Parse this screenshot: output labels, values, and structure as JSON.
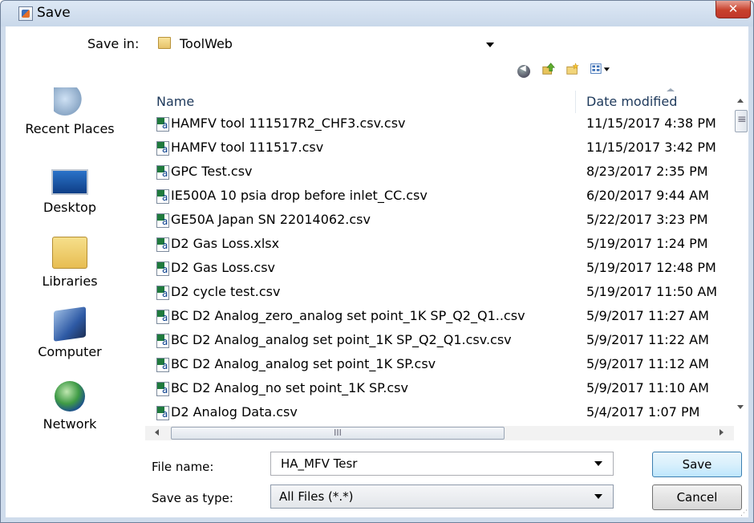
{
  "window": {
    "title": "Save",
    "close_symbol": "✕",
    "title_icon": "java-cup-icon"
  },
  "save_in": {
    "label": "Save in:",
    "value": "ToolWeb",
    "icon": "folder-icon"
  },
  "toolbar": {
    "icons": [
      "back-icon",
      "up-folder-icon",
      "new-folder-icon",
      "view-menu-icon"
    ]
  },
  "places": [
    {
      "label": "Recent Places",
      "icon": "recent-places-icon"
    },
    {
      "label": "Desktop",
      "icon": "desktop-icon"
    },
    {
      "label": "Libraries",
      "icon": "libraries-icon"
    },
    {
      "label": "Computer",
      "icon": "computer-icon"
    },
    {
      "label": "Network",
      "icon": "network-icon"
    }
  ],
  "file_list": {
    "columns": [
      "Name",
      "Date modified"
    ],
    "rows": [
      {
        "name": "HAMFV tool 111517R2_CHF3.csv.csv",
        "date": "11/15/2017 4:38 PM"
      },
      {
        "name": "HAMFV tool 111517.csv",
        "date": "11/15/2017 3:42 PM"
      },
      {
        "name": "GPC Test.csv",
        "date": "8/23/2017 2:35 PM"
      },
      {
        "name": "IE500A 10 psia drop before inlet_CC.csv",
        "date": "6/20/2017 9:44 AM"
      },
      {
        "name": "GE50A Japan SN 22014062.csv",
        "date": "5/22/2017 3:23 PM"
      },
      {
        "name": "D2 Gas Loss.xlsx",
        "date": "5/19/2017 1:24 PM"
      },
      {
        "name": "D2 Gas Loss.csv",
        "date": "5/19/2017 12:48 PM"
      },
      {
        "name": "D2 cycle test.csv",
        "date": "5/19/2017 11:50 AM"
      },
      {
        "name": "BC D2 Analog_zero_analog set point_1K SP_Q2_Q1..csv",
        "date": "5/9/2017 11:27 AM"
      },
      {
        "name": "BC D2 Analog_analog set point_1K SP_Q2_Q1.csv.csv",
        "date": "5/9/2017 11:22 AM"
      },
      {
        "name": "BC D2 Analog_analog set point_1K SP.csv",
        "date": "5/9/2017 11:12 AM"
      },
      {
        "name": "BC D2 Analog_no set point_1K SP.csv",
        "date": "5/9/2017 11:10 AM"
      },
      {
        "name": "D2 Analog Data.csv",
        "date": "5/4/2017 1:07 PM"
      }
    ]
  },
  "scrollbar": {
    "h_thumb_grip": "III"
  },
  "file_name": {
    "label": "File name:",
    "value": "HA_MFV Tesr"
  },
  "save_as_type": {
    "label": "Save as type:",
    "value": "All Files (*.*)"
  },
  "buttons": {
    "save": "Save",
    "cancel": "Cancel"
  },
  "colors": {
    "title_bar": "#c9d8ea",
    "close_button": "#c8412d",
    "header_text": "#1e395b"
  }
}
